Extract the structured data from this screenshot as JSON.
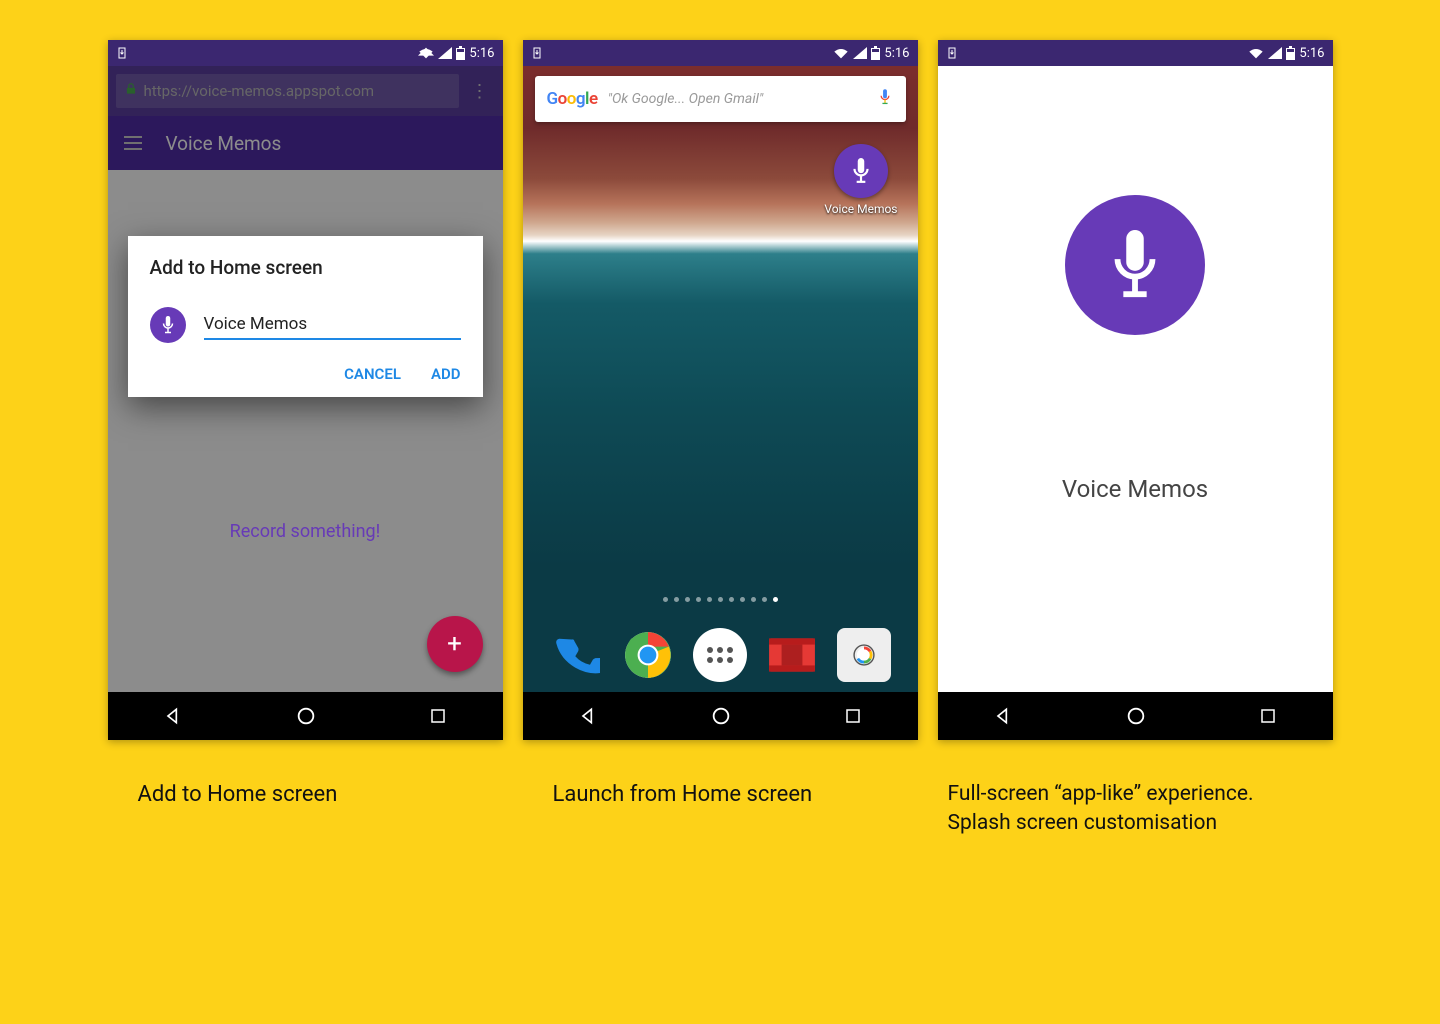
{
  "status": {
    "time": "5:16"
  },
  "phone1": {
    "url": "https://voice-memos.appspot.com",
    "app_title": "Voice Memos",
    "behind_cta": "Record something!",
    "dialog": {
      "title": "Add to Home screen",
      "input_value": "Voice Memos",
      "cancel": "CANCEL",
      "add": "ADD"
    }
  },
  "phone2": {
    "search_hint": "\"Ok Google... Open Gmail\"",
    "home_icon_label": "Voice Memos"
  },
  "phone3": {
    "app_name": "Voice Memos"
  },
  "captions": {
    "c1": "Add to Home screen",
    "c2": "Launch from Home screen",
    "c3a": "Full-screen “app-like” experience.",
    "c3b": "Splash screen customisation"
  },
  "google_logo_text": "Google"
}
